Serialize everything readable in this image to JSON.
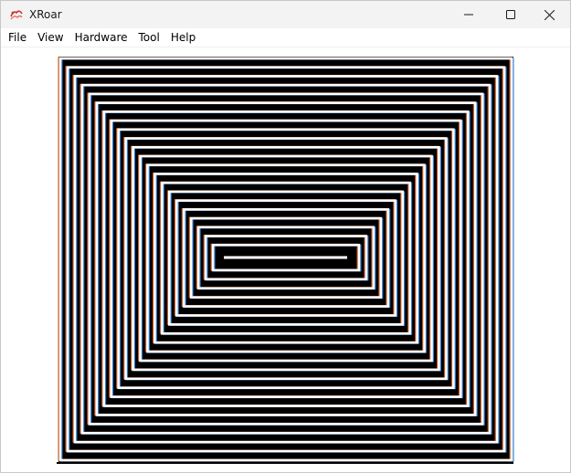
{
  "window": {
    "title": "XRoar"
  },
  "menu": {
    "items": [
      "File",
      "View",
      "Hardware",
      "Tool",
      "Help"
    ]
  },
  "icons": {
    "app": "xroar-app-icon",
    "minimize": "minimize-icon",
    "maximize": "maximize-icon",
    "close": "close-icon"
  },
  "colors": {
    "titlebar_bg": "#f3f3f3",
    "screen_black": "#000000",
    "screen_white": "#ffffff",
    "artifact_orange": "#c4561c",
    "artifact_blue": "#2f7fd6"
  },
  "screen": {
    "pattern": "concentric-rectangles",
    "ring_count": 22
  }
}
